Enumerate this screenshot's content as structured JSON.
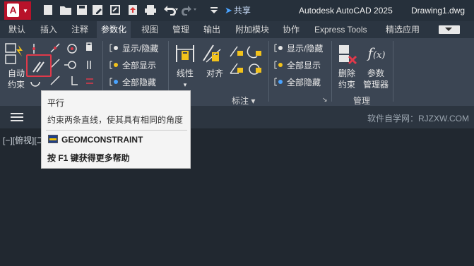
{
  "titlebar": {
    "app_logo": "A",
    "share_label": "共享",
    "app_name": "Autodesk AutoCAD 2025",
    "document": "Drawing1.dwg",
    "quick_access_icons": [
      "new-icon",
      "open-icon",
      "save-icon",
      "save-as-icon",
      "share-icon",
      "upload-icon",
      "print-icon",
      "undo-icon",
      "redo-icon",
      "dropdown-icon"
    ]
  },
  "tabs": [
    {
      "label": "默认"
    },
    {
      "label": "插入"
    },
    {
      "label": "注释"
    },
    {
      "label": "参数化",
      "active": true
    },
    {
      "label": "视图"
    },
    {
      "label": "管理"
    },
    {
      "label": "输出"
    },
    {
      "label": "附加模块"
    },
    {
      "label": "协作"
    },
    {
      "label": "Express Tools"
    },
    {
      "label": "精选应用"
    }
  ],
  "ribbon": {
    "auto_constrain": "自动\n约束",
    "geometric": {
      "show_hide": "显示/隐藏",
      "show_all": "全部显示",
      "hide_all": "全部隐藏"
    },
    "linear_label": "线性",
    "aligned_label": "对齐",
    "dimensional": {
      "show_hide": "显示/隐藏",
      "show_all": "全部显示",
      "hide_all": "全部隐藏"
    },
    "dim_panel_label": "标注 ▾",
    "delete_constraints": "删除\n约束",
    "param_manager": "参数\n管理器",
    "manage_panel_label": "管理",
    "colors": {
      "accent": "#e0394a",
      "ribbon_bg": "#3b4553"
    }
  },
  "tooltip": {
    "title": "平行",
    "description": "约束两条直线，使其具有相同的角度",
    "command": "GEOMCONSTRAINT",
    "help": "按 F1 键获得更多帮助"
  },
  "command_bar": {
    "watermark": "软件自学网：RJZXW.COM"
  },
  "viewport": {
    "label": "[−][俯视][二"
  }
}
